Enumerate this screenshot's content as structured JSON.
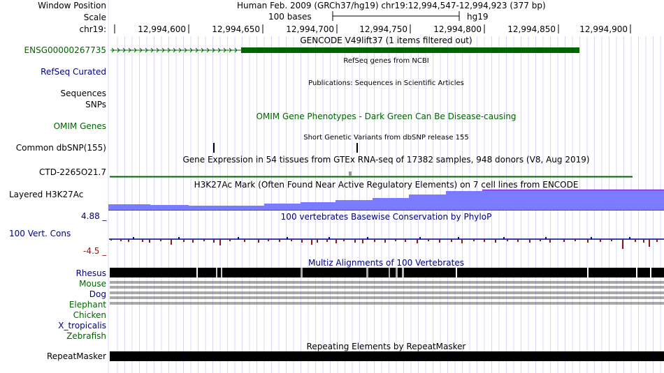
{
  "colors": {
    "black": "#000000",
    "gene_green": "#006400",
    "navy": "#000080",
    "dark_red": "#8b1a1a",
    "layered_blue": "#7b7bff",
    "layered_purple": "#8a2be2",
    "grid_blue": "#d8d8f5",
    "gray": "#999999"
  },
  "header": {
    "window_position_label": "Window Position",
    "window_position_value": "Human Feb. 2009 (GRCh37/hg19)   chr19:12,994,547-12,994,923 (377 bp)",
    "scale_label": "Scale",
    "scale_bar_label": "100 bases",
    "scale_assembly": "hg19",
    "chrom_label": "chr19:",
    "ticks": [
      "12,994,600",
      "12,994,650",
      "12,994,700",
      "12,994,750",
      "12,994,800",
      "12,994,850",
      "12,994,900"
    ]
  },
  "tracks": {
    "gencode": {
      "title": "GENCODE V49lift37 (1 items filtered out)",
      "label": "ENSG00000267735",
      "strand_glyph": "›"
    },
    "refseq": {
      "title": "RefSeq genes from NCBI",
      "label": "RefSeq Curated"
    },
    "sequences": {
      "title": "Publications: Sequences in Scientific Articles",
      "label": "Sequences"
    },
    "snps": {
      "label": "SNPs"
    },
    "omim": {
      "title": "OMIM Gene Phenotypes - Dark Green Can Be Disease-causing",
      "label": "OMIM Genes"
    },
    "dbsnp": {
      "title": "Short Genetic Variants from dbSNP release 155",
      "label": "Common dbSNP(155)"
    },
    "gtex": {
      "title": "Gene Expression in 54 tissues from GTEx RNA-seq of 17382 samples, 948 donors (V8, Aug 2019)",
      "label": "CTD-2265O21.7"
    },
    "h3k27ac": {
      "title": "H3K27Ac Mark (Often Found Near Active Regulatory Elements) on 7 cell lines from ENCODE",
      "label": "Layered H3K27Ac"
    },
    "phylop": {
      "title": "100 vertebrates Basewise Conservation by PhyloP",
      "label": "100 Vert. Cons",
      "max_label": "4.88 _",
      "min_label": "-4.5 _"
    },
    "multiz": {
      "title": "Multiz Alignments of 100 Vertebrates",
      "species": [
        "Rhesus",
        "Mouse",
        "Dog",
        "Elephant",
        "Chicken",
        "X_tropicalis",
        "Zebrafish"
      ]
    },
    "repeatmasker": {
      "title": "Repeating Elements by RepeatMasker",
      "label": "RepeatMasker"
    }
  }
}
